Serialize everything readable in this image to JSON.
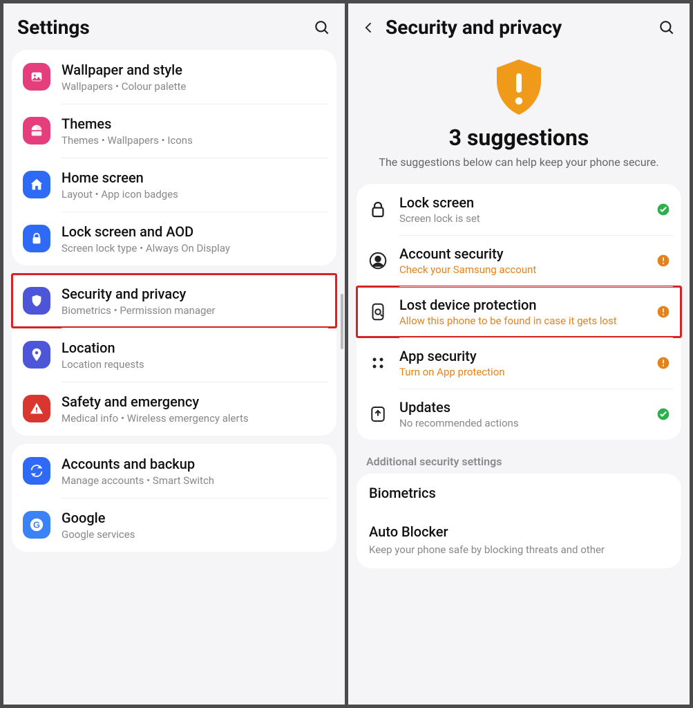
{
  "left": {
    "title": "Settings",
    "groups": [
      [
        {
          "id": "wallpaper",
          "title": "Wallpaper and style",
          "sub": "Wallpapers  •  Colour palette",
          "iconColor": "magenta",
          "icon": "image"
        },
        {
          "id": "themes",
          "title": "Themes",
          "sub": "Themes  •  Wallpapers  •  Icons",
          "iconColor": "magenta",
          "icon": "themes"
        },
        {
          "id": "home",
          "title": "Home screen",
          "sub": "Layout  •  App icon badges",
          "iconColor": "blue",
          "icon": "home"
        },
        {
          "id": "lockscreen",
          "title": "Lock screen and AOD",
          "sub": "Screen lock type  •  Always On Display",
          "iconColor": "blue",
          "icon": "lock"
        }
      ],
      [
        {
          "id": "security",
          "title": "Security and privacy",
          "sub": "Biometrics  •  Permission manager",
          "iconColor": "indigo",
          "icon": "shield",
          "highlight": true
        },
        {
          "id": "location",
          "title": "Location",
          "sub": "Location requests",
          "iconColor": "indigo",
          "icon": "pin"
        },
        {
          "id": "safety",
          "title": "Safety and emergency",
          "sub": "Medical info  •  Wireless emergency alerts",
          "iconColor": "red",
          "icon": "alert"
        }
      ],
      [
        {
          "id": "accounts",
          "title": "Accounts and backup",
          "sub": "Manage accounts  •  Smart Switch",
          "iconColor": "blue",
          "icon": "sync"
        },
        {
          "id": "google",
          "title": "Google",
          "sub": "Google services",
          "iconColor": "gblue",
          "icon": "g"
        }
      ]
    ]
  },
  "right": {
    "title": "Security and privacy",
    "hero": {
      "count_text": "3 suggestions",
      "desc": "The suggestions below can help keep your phone secure."
    },
    "items": [
      {
        "id": "lock",
        "title": "Lock screen",
        "sub": "Screen lock is set",
        "status": "ok",
        "icon": "lock2",
        "warn": false
      },
      {
        "id": "account",
        "title": "Account security",
        "sub": "Check your Samsung account",
        "status": "warn",
        "icon": "user",
        "warn": true
      },
      {
        "id": "lost",
        "title": "Lost device protection",
        "sub": "Allow this phone to be found in case it gets lost",
        "status": "warn",
        "icon": "finddevice",
        "warn": true,
        "highlight": true
      },
      {
        "id": "appsec",
        "title": "App security",
        "sub": "Turn on App protection",
        "status": "warn",
        "icon": "apps",
        "warn": true
      },
      {
        "id": "updates",
        "title": "Updates",
        "sub": "No recommended actions",
        "status": "ok",
        "icon": "update",
        "warn": false
      }
    ],
    "section_label": "Additional security settings",
    "additional": [
      {
        "id": "biometrics",
        "title": "Biometrics",
        "sub": ""
      },
      {
        "id": "autoblocker",
        "title": "Auto Blocker",
        "sub": "Keep your phone safe by blocking threats and other"
      }
    ]
  }
}
